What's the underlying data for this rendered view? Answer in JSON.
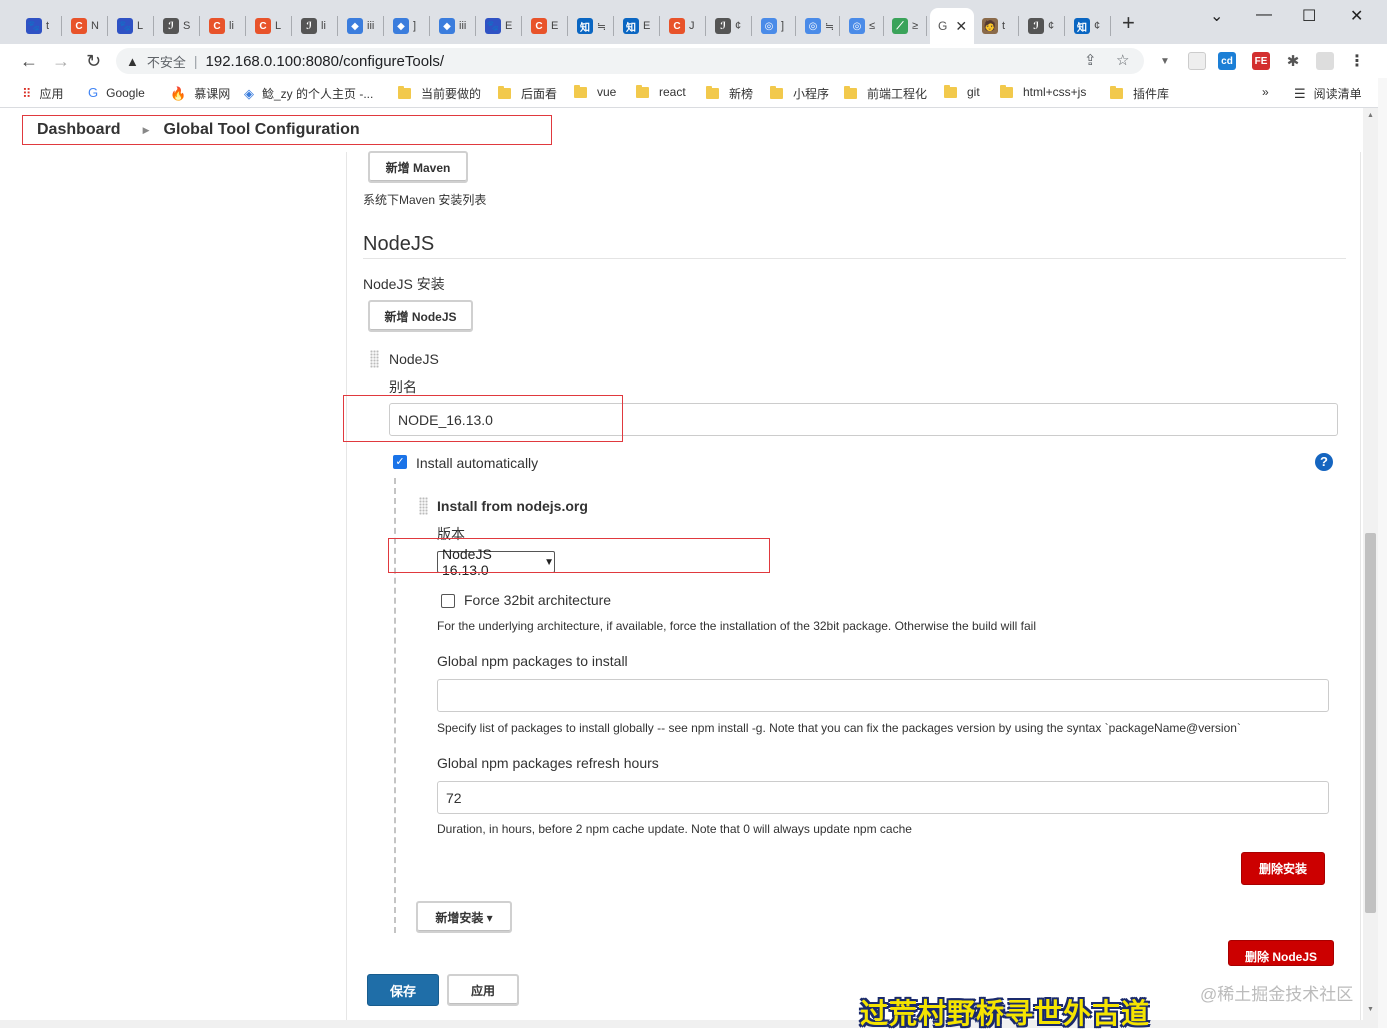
{
  "browser": {
    "tabs": [
      {
        "favicon": "🐾",
        "color": "#2f52c4",
        "label": "t"
      },
      {
        "favicon": "C",
        "color": "#e8532a",
        "label": "N"
      },
      {
        "favicon": "🐾",
        "color": "#2f52c4",
        "label": "L"
      },
      {
        "favicon": "ℐ",
        "color": "#555555",
        "label": "S"
      },
      {
        "favicon": "C",
        "color": "#e8532a",
        "label": "li"
      },
      {
        "favicon": "C",
        "color": "#e8532a",
        "label": "L"
      },
      {
        "favicon": "ℐ",
        "color": "#555555",
        "label": "li"
      },
      {
        "favicon": "◆",
        "color": "#3b7ddd",
        "label": "iii"
      },
      {
        "favicon": "◆",
        "color": "#3b7ddd",
        "label": "]"
      },
      {
        "favicon": "◆",
        "color": "#3b7ddd",
        "label": "iii"
      },
      {
        "favicon": "🐾",
        "color": "#2f52c4",
        "label": "E"
      },
      {
        "favicon": "C",
        "color": "#e8532a",
        "label": "E"
      },
      {
        "favicon": "知",
        "color": "#0a66c2",
        "label": "≒"
      },
      {
        "favicon": "知",
        "color": "#0a66c2",
        "label": "E"
      },
      {
        "favicon": "C",
        "color": "#e8532a",
        "label": "J"
      },
      {
        "favicon": "ℐ",
        "color": "#555555",
        "label": "¢"
      },
      {
        "favicon": "◎",
        "color": "#4a8be8",
        "label": "]"
      },
      {
        "favicon": "◎",
        "color": "#4a8be8",
        "label": "≒"
      },
      {
        "favicon": "◎",
        "color": "#4a8be8",
        "label": "≤"
      },
      {
        "favicon": "⟋",
        "color": "#3aa35a",
        "label": "≥"
      },
      {
        "favicon": "🧑",
        "color": "#8a6a4a",
        "label": "t"
      },
      {
        "favicon": "ℐ",
        "color": "#555555",
        "label": "¢"
      },
      {
        "favicon": "知",
        "color": "#0a66c2",
        "label": "¢"
      }
    ],
    "active_tab": {
      "label": "G"
    },
    "window_controls": {
      "chevron": "⌄",
      "minimize": "—",
      "maximize": "☐",
      "close": "✕"
    },
    "omnibox": {
      "security_icon": "▲",
      "insecure_text": "不安全",
      "url": "192.168.0.100:8080/configureTools/"
    },
    "bookmarks": [
      {
        "icon": "apps",
        "label": "应用"
      },
      {
        "icon": "google",
        "label": "Google"
      },
      {
        "icon": "fire",
        "label": "慕课网"
      },
      {
        "icon": "diamond",
        "label": "鲶_zy 的个人主页 -..."
      },
      {
        "icon": "folder",
        "label": "当前要做的"
      },
      {
        "icon": "folder",
        "label": "后面看"
      },
      {
        "icon": "folder",
        "label": "vue"
      },
      {
        "icon": "folder",
        "label": "react"
      },
      {
        "icon": "folder",
        "label": "新榜"
      },
      {
        "icon": "folder",
        "label": "小程序"
      },
      {
        "icon": "folder",
        "label": "前端工程化"
      },
      {
        "icon": "folder",
        "label": "git"
      },
      {
        "icon": "folder",
        "label": "html+css+js"
      },
      {
        "icon": "folder",
        "label": "插件库"
      }
    ],
    "bookmarks_more": "»",
    "reading_list": "阅读清单"
  },
  "breadcrumb": {
    "items": [
      "Dashboard",
      "Global Tool Configuration"
    ]
  },
  "maven": {
    "add_button": "新增 Maven",
    "help": "系统下Maven 安装列表"
  },
  "nodejs": {
    "title": "NodeJS",
    "installations_label": "NodeJS 安装",
    "add_button": "新增 NodeJS",
    "item_header": "NodeJS",
    "alias_label": "别名",
    "alias_value": "NODE_16.13.0",
    "install_automatically": {
      "label": "Install automatically",
      "checked": true
    },
    "installer": {
      "title": "Install from nodejs.org",
      "version_label": "版本",
      "version_value": "NodeJS 16.13.0",
      "force32": {
        "label": "Force 32bit architecture",
        "checked": false
      },
      "force32_help": "For the underlying architecture, if available, force the installation of the 32bit package. Otherwise the build will fail",
      "npm_packages_label": "Global npm packages to install",
      "npm_packages_value": "",
      "npm_packages_help": "Specify list of packages to install globally -- see npm install -g. Note that you can fix the packages version by using the syntax `packageName@version`",
      "refresh_label": "Global npm packages refresh hours",
      "refresh_value": "72",
      "refresh_help": "Duration, in hours, before 2 npm cache update. Note that 0 will always update npm cache",
      "delete_installer_button": "删除安装"
    },
    "add_installer_button": "新增安装 ▾",
    "delete_nodejs_button": "删除 NodeJS"
  },
  "footer": {
    "save_button": "保存",
    "apply_button": "应用"
  },
  "overlay": {
    "watermark": "@稀土掘金技术社区",
    "subtitle": "过荒村野桥寻世外古道"
  },
  "colors": {
    "accent_blue": "#1f6ea8",
    "danger_red": "#cc0000",
    "annotation_red": "#e0393e"
  }
}
